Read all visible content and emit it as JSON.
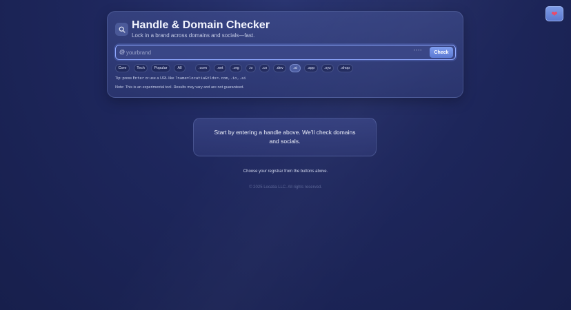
{
  "header": {
    "title": "Handle & Domain Checker",
    "subtitle": "Lock in a brand across domains and socials—fast."
  },
  "search": {
    "prefix": "@",
    "placeholder": "yourbrand",
    "value": "",
    "hint_dots": "••••",
    "check_label": "Check"
  },
  "presets": [
    {
      "label": "Core"
    },
    {
      "label": "Tech"
    },
    {
      "label": "Popular"
    },
    {
      "label": "All"
    }
  ],
  "tlds": [
    {
      "label": ".com",
      "active": false
    },
    {
      "label": ".net",
      "active": false
    },
    {
      "label": ".org",
      "active": false
    },
    {
      "label": ".io",
      "active": false
    },
    {
      "label": ".co",
      "active": false
    },
    {
      "label": ".dev",
      "active": false
    },
    {
      "label": ".ai",
      "active": true
    },
    {
      "label": ".app",
      "active": false
    },
    {
      "label": ".xyz",
      "active": false
    },
    {
      "label": ".shop",
      "active": false
    }
  ],
  "tip": {
    "prefix": "Tip: press",
    "key": "Enter",
    "middle": "or use a URL like",
    "example": "?name=locatia&tlds=.com,.io,.ai"
  },
  "note": "Note: This is an experimental tool. Results may vary and are not guaranteed.",
  "empty_state": "Start by entering a handle above. We’ll check domains and socials.",
  "registrar_note": "Choose your registrar from the buttons above.",
  "footer": "© 2025 Locatia LLC. All rights reserved.",
  "theme_toggle": {
    "icon": "heart-icon",
    "glyph": "❤"
  },
  "colors": {
    "accent": "#6f8de6",
    "background": "#1e275d"
  }
}
